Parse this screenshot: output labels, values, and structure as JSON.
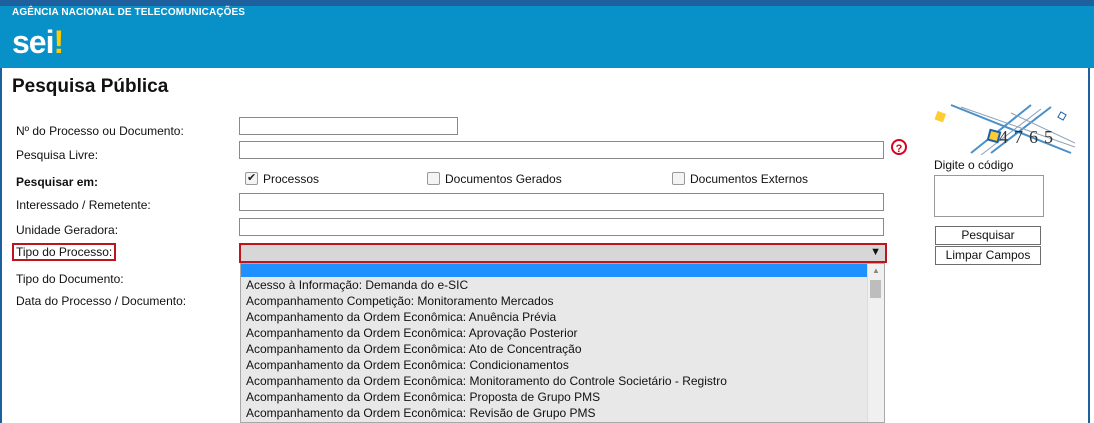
{
  "header": {
    "agency": "AGÊNCIA NACIONAL DE TELECOMUNICAÇÕES",
    "logo_text": "sei",
    "logo_mark": "!",
    "bar_color": "#0891c9",
    "accent_color": "#1e5f9e"
  },
  "page": {
    "title": "Pesquisa Pública"
  },
  "form": {
    "processo_label": "Nº do Processo ou Documento:",
    "processo_value": "",
    "pesquisa_livre_label": "Pesquisa Livre:",
    "pesquisa_livre_value": "",
    "help_icon": "question-circle-icon",
    "help_glyph": "?",
    "pesquisar_em_label": "Pesquisar em:",
    "checkboxes": [
      {
        "label": "Processos",
        "checked": true
      },
      {
        "label": "Documentos Gerados",
        "checked": false
      },
      {
        "label": "Documentos Externos",
        "checked": false
      }
    ],
    "interessado_label": "Interessado / Remetente:",
    "interessado_value": "",
    "unidade_label": "Unidade Geradora:",
    "unidade_value": "",
    "tipo_processo_label": "Tipo do Processo:",
    "tipo_processo_value": "",
    "tipo_processo_arrow": "▼",
    "tipo_documento_label": "Tipo do Documento:",
    "data_label": "Data do Processo / Documento:"
  },
  "dropdown": {
    "selected_color": "#1e90ff",
    "options": [
      "Acesso à Informação: Demanda do e-SIC",
      "Acompanhamento Competição: Monitoramento Mercados",
      "Acompanhamento da Ordem Econômica: Anuência Prévia",
      "Acompanhamento da Ordem Econômica: Aprovação Posterior",
      "Acompanhamento da Ordem Econômica: Ato de Concentração",
      "Acompanhamento da Ordem Econômica: Condicionamentos",
      "Acompanhamento da Ordem Econômica: Monitoramento do Controle Societário - Registro",
      "Acompanhamento da Ordem Econômica: Proposta de Grupo PMS",
      "Acompanhamento da Ordem Econômica: Revisão de Grupo PMS"
    ],
    "scroll_up_glyph": "▲"
  },
  "captcha": {
    "code": "4765",
    "prompt": "Digite o código",
    "value": ""
  },
  "buttons": {
    "search": "Pesquisar",
    "clear": "Limpar Campos"
  }
}
